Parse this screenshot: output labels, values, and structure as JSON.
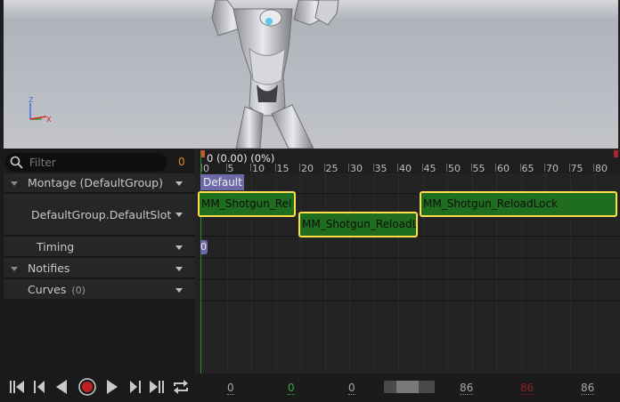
{
  "search": {
    "placeholder": "Filter",
    "count": "0"
  },
  "tracks": {
    "montage": "Montage (DefaultGroup)",
    "slot": "DefaultGroup.DefaultSlot",
    "timing": "Timing",
    "notifies": "Notifies",
    "curves": "Curves",
    "curves_count": "(0)"
  },
  "timeline": {
    "current_position": "0 (0.00) (0%)",
    "ticks": [
      "0",
      "5",
      "10",
      "15",
      "20",
      "25",
      "30",
      "35",
      "40",
      "45",
      "50",
      "55",
      "60",
      "65",
      "70",
      "75",
      "80"
    ],
    "section_label": "Default",
    "segments": [
      "MM_Shotgun_Rel",
      "MM_Shotgun_ReloadL",
      "MM_Shotgun_ReloadLock"
    ],
    "timing_label": "0"
  },
  "bottombar": {
    "view_start": "0",
    "playback_start": "0",
    "current_frame": "0",
    "view_end": "86",
    "playback_end": "86",
    "total_end": "86"
  },
  "transport": [
    "to-start-icon",
    "step-back-icon",
    "play-reverse-icon",
    "record-icon",
    "play-icon",
    "step-forward-icon",
    "to-end-icon",
    "loop-icon"
  ],
  "colors": {
    "segment_fill": "#1f6e1f",
    "segment_border": "#ffde4a",
    "section_tag": "#6e6aa8",
    "counter": "#e08a1e",
    "playhead": "#2e8b2e",
    "record": "#c02020"
  }
}
